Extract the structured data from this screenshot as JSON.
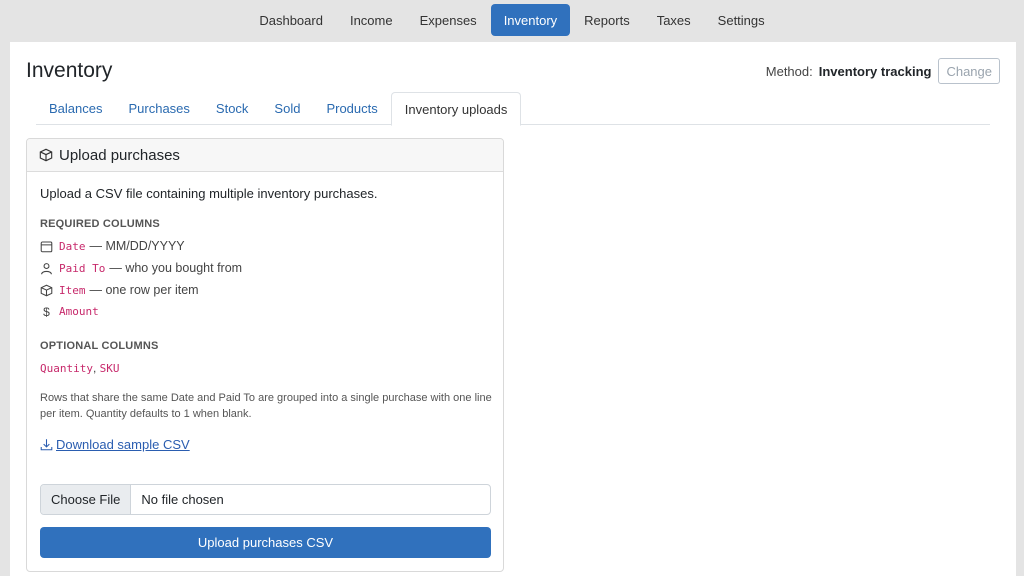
{
  "nav": {
    "items": [
      {
        "label": "Dashboard"
      },
      {
        "label": "Income"
      },
      {
        "label": "Expenses"
      },
      {
        "label": "Inventory",
        "active": true
      },
      {
        "label": "Reports"
      },
      {
        "label": "Taxes"
      },
      {
        "label": "Settings"
      }
    ]
  },
  "page": {
    "title": "Inventory",
    "method_label": "Method:",
    "method_value": "Inventory tracking",
    "change_label": "Change"
  },
  "tabs": [
    {
      "label": "Balances"
    },
    {
      "label": "Purchases"
    },
    {
      "label": "Stock"
    },
    {
      "label": "Sold"
    },
    {
      "label": "Products"
    },
    {
      "label": "Inventory uploads",
      "active": true
    }
  ],
  "card": {
    "title": "Upload purchases",
    "intro": "Upload a CSV file containing multiple inventory purchases.",
    "required_label": "REQUIRED COLUMNS",
    "required": [
      {
        "icon": "calendar-icon",
        "code": "Date",
        "desc": "— MM/DD/YYYY"
      },
      {
        "icon": "person-icon",
        "code": "Paid To",
        "desc": "— who you bought from"
      },
      {
        "icon": "box-icon",
        "code": "Item",
        "desc": "— one row per item"
      },
      {
        "icon": "dollar-icon",
        "code": "Amount",
        "desc": ""
      }
    ],
    "optional_label": "OPTIONAL COLUMNS",
    "optional": {
      "code1": "Quantity",
      "sep": ",",
      "code2": "SKU"
    },
    "note": "Rows that share the same Date and Paid To are grouped into a single purchase with one line per item. Quantity defaults to 1 when blank.",
    "download_label": "Download sample CSV",
    "choose_file_label": "Choose File",
    "file_status": "No file chosen",
    "upload_label": "Upload purchases CSV"
  },
  "colors": {
    "accent": "#3071bd",
    "code": "#c7296b",
    "link": "#2a5db0"
  }
}
